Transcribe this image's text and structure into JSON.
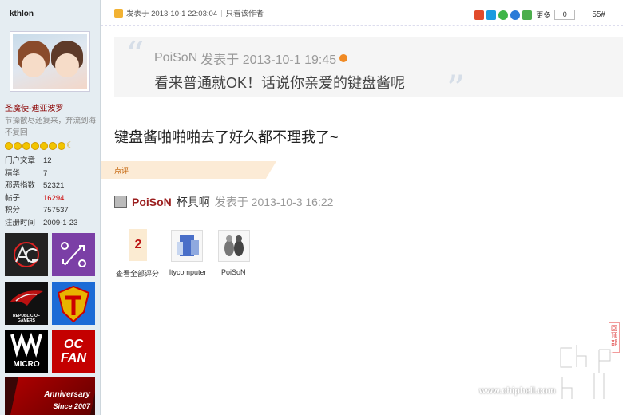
{
  "sidebar": {
    "username": "kthlon",
    "group": "圣魔使-迪亚波罗",
    "signature": "节操散尽还复来，弃流到海不复回",
    "stats": [
      {
        "label": "门户文章",
        "value": "12"
      },
      {
        "label": "精华",
        "value": "7"
      },
      {
        "label": "邪恶指数",
        "value": "52321"
      },
      {
        "label": "帖子",
        "value": "16294"
      },
      {
        "label": "积分",
        "value": "757537"
      },
      {
        "label": "注册时间",
        "value": "2009-1-23"
      }
    ],
    "badges": {
      "b3": "REPUBLIC OF GAMERS",
      "b5": "MICRO",
      "b6": "OC FAN",
      "b7a": "Anniversary",
      "b7b": "Since 2007"
    }
  },
  "post": {
    "posted_at": "发表于 2013-10-1 22:03:04",
    "only_author": "只看该作者",
    "more": "更多",
    "share_count": "0",
    "floor": "55#",
    "quote": {
      "author": "PoiSoN",
      "meta": "发表于 2013-10-1 19:45",
      "text": "看来普通就OK！话说你亲爱的键盘酱呢"
    },
    "message": "键盘酱啪啪啪去了好久都不理我了~"
  },
  "ratings": {
    "tab_label": "点评",
    "comment_user": "PoiSoN",
    "comment_text": "杯具啊",
    "comment_time": "发表于 2013-10-3 16:22",
    "score": "2",
    "view_all": "查看全部评分",
    "raters": [
      "ltycomputer",
      "PoiSoN"
    ]
  },
  "back_to_top": "回顶部",
  "watermark": "www.chiphell.com",
  "colors": {
    "sidebar_bg": "#e5edf2",
    "username_red": "#9b1e1e",
    "accent_orange": "#f08a24"
  }
}
